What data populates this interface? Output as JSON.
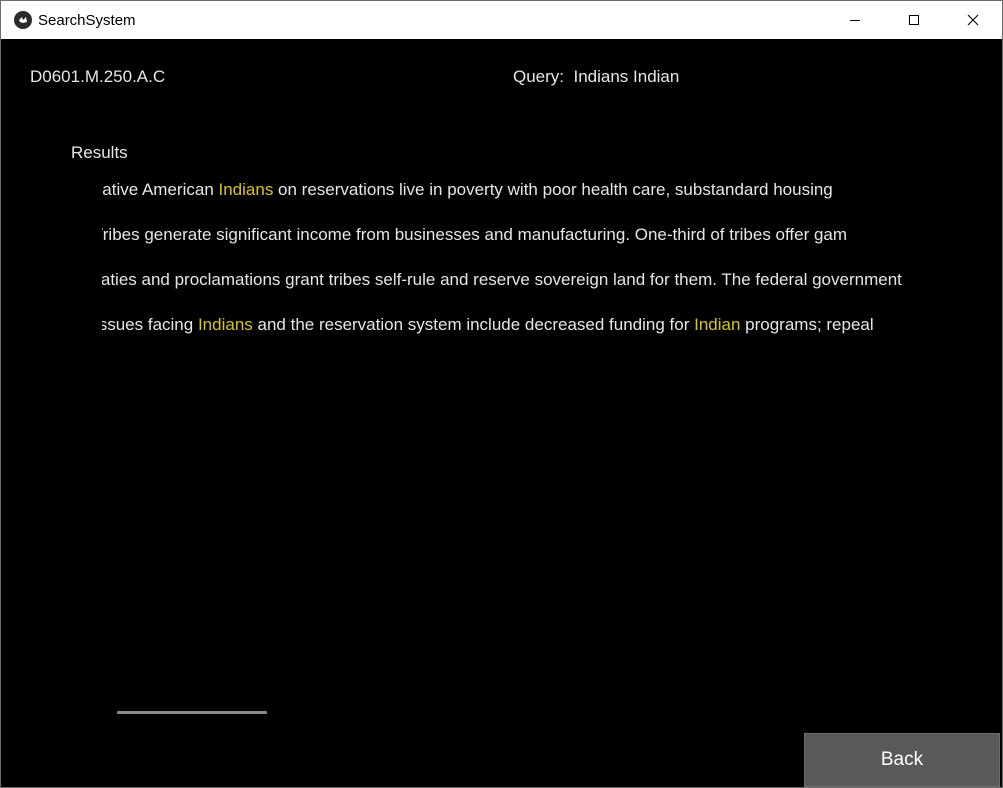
{
  "window": {
    "title": "SearchSystem"
  },
  "header": {
    "doc_id": "D0601.M.250.A.C",
    "query_label": "Query:",
    "query_value": "Indians Indian"
  },
  "results": {
    "label": "Results",
    "highlight_color": "#d9c31c",
    "lines": [
      [
        {
          "text": "Native American ",
          "hl": false
        },
        {
          "text": "Indians",
          "hl": true
        },
        {
          "text": " on reservations live in poverty with poor health care, substandard housing",
          "hl": false
        }
      ],
      [
        {
          "text": "Tribes generate significant income from businesses and manufacturing. One-third of tribes offer gam",
          "hl": false
        }
      ],
      [
        {
          "text": "Treaties and proclamations grant tribes self-rule and reserve sovereign land for them. The federal government pays for m",
          "hl": false
        }
      ],
      [
        {
          "text": "Issues facing ",
          "hl": false
        },
        {
          "text": "Indians",
          "hl": true
        },
        {
          "text": " and the reservation system include decreased funding for ",
          "hl": false
        },
        {
          "text": "Indian",
          "hl": true
        },
        {
          "text": " programs; repeal",
          "hl": false
        }
      ]
    ]
  },
  "footer": {
    "back_label": "Back"
  }
}
